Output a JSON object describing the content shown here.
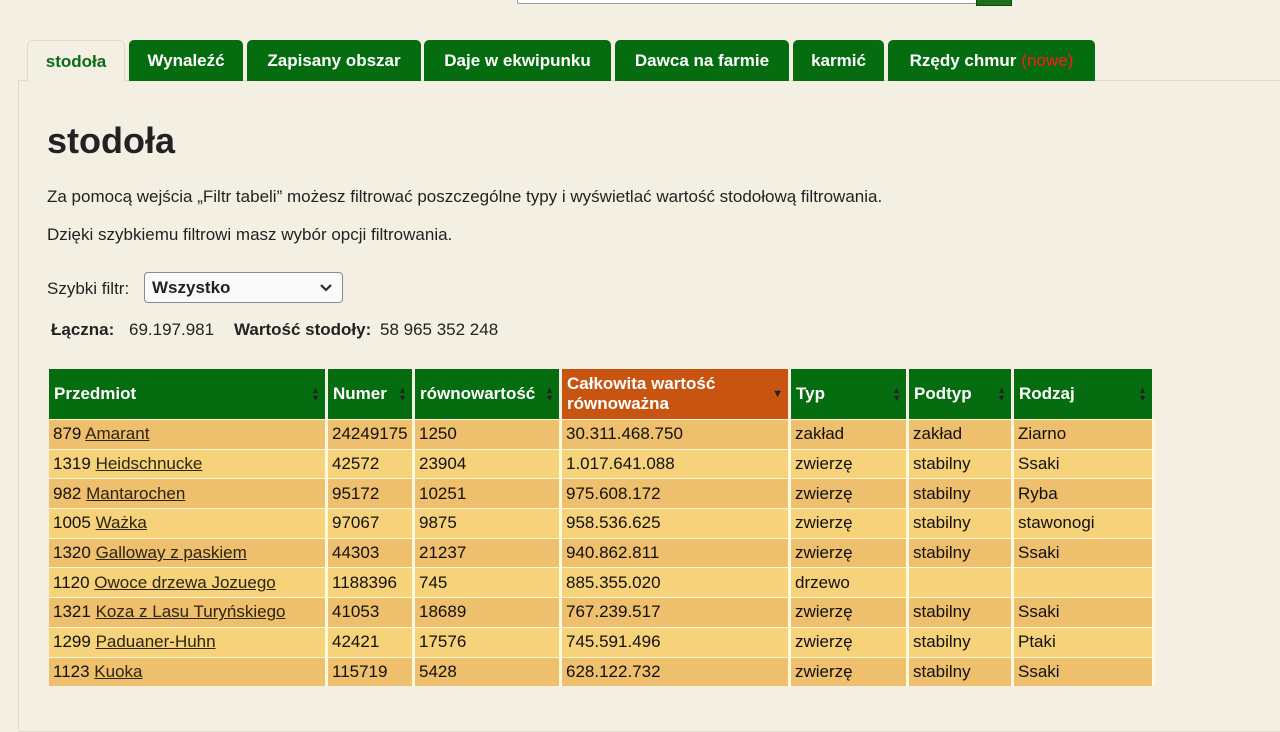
{
  "tabs": [
    {
      "label": "stodoła",
      "active": true
    },
    {
      "label": "Wynaleźć"
    },
    {
      "label": "Zapisany obszar"
    },
    {
      "label": "Daje w ekwipunku"
    },
    {
      "label": "Dawca na farmie"
    },
    {
      "label": "karmić"
    },
    {
      "label": "Rzędy chmur",
      "badge": "(nowe)"
    }
  ],
  "page": {
    "title": "stodoła",
    "intro1": "Za pomocą wejścia „Filtr tabeli” możesz filtrować poszczególne typy i wyświetlać wartość stodołową filtrowania.",
    "intro2": "Dzięki szybkiemu filtrowi masz wybór opcji filtrowania."
  },
  "filter": {
    "label": "Szybki filtr:",
    "value": "Wszystko"
  },
  "totals": {
    "total_label": "Łączna:",
    "total_value": "69.197.981",
    "barn_label": "Wartość stodoły:",
    "barn_value": "58 965 352 248"
  },
  "table": {
    "headers": [
      "Przedmiot",
      "Numer",
      "równowartość",
      "Całkowita wartość równoważna",
      "Typ",
      "Podtyp",
      "Rodzaj"
    ],
    "sorted_column": 3,
    "rows": [
      {
        "id": "879",
        "name": "Amarant",
        "numer": "24249175",
        "rown": "1250",
        "total": "30.311.468.750",
        "typ": "zakład",
        "podtyp": "zakład",
        "rodzaj": "Ziarno"
      },
      {
        "id": "1319",
        "name": "Heidschnucke",
        "numer": "42572",
        "rown": "23904",
        "total": "1.017.641.088",
        "typ": "zwierzę",
        "podtyp": "stabilny",
        "rodzaj": "Ssaki"
      },
      {
        "id": "982",
        "name": "Mantarochen",
        "numer": "95172",
        "rown": "10251",
        "total": "975.608.172",
        "typ": "zwierzę",
        "podtyp": "stabilny",
        "rodzaj": "Ryba"
      },
      {
        "id": "1005",
        "name": "Ważka",
        "numer": "97067",
        "rown": "9875",
        "total": "958.536.625",
        "typ": "zwierzę",
        "podtyp": "stabilny",
        "rodzaj": "stawonogi"
      },
      {
        "id": "1320",
        "name": "Galloway z paskiem",
        "numer": "44303",
        "rown": "21237",
        "total": "940.862.811",
        "typ": "zwierzę",
        "podtyp": "stabilny",
        "rodzaj": "Ssaki"
      },
      {
        "id": "1120",
        "name": "Owoce drzewa Jozuego",
        "numer": "1188396",
        "rown": "745",
        "total": "885.355.020",
        "typ": "drzewo",
        "podtyp": "",
        "rodzaj": ""
      },
      {
        "id": "1321",
        "name": "Koza z Lasu Turyńskiego",
        "numer": "41053",
        "rown": "18689",
        "total": "767.239.517",
        "typ": "zwierzę",
        "podtyp": "stabilny",
        "rodzaj": "Ssaki"
      },
      {
        "id": "1299",
        "name": "Paduaner-Huhn",
        "numer": "42421",
        "rown": "17576",
        "total": "745.591.496",
        "typ": "zwierzę",
        "podtyp": "stabilny",
        "rodzaj": "Ptaki"
      },
      {
        "id": "1123",
        "name": "Kuoka",
        "numer": "115719",
        "rown": "5428",
        "total": "628.122.732",
        "typ": "zwierzę",
        "podtyp": "stabilny",
        "rodzaj": "Ssaki"
      }
    ]
  },
  "colors": {
    "tab_green": "#056d0f",
    "sorted_header": "#c85412",
    "row_odd": "#eebf6c",
    "row_even": "#f6d27a",
    "badge_red": "#ff1a1a"
  }
}
